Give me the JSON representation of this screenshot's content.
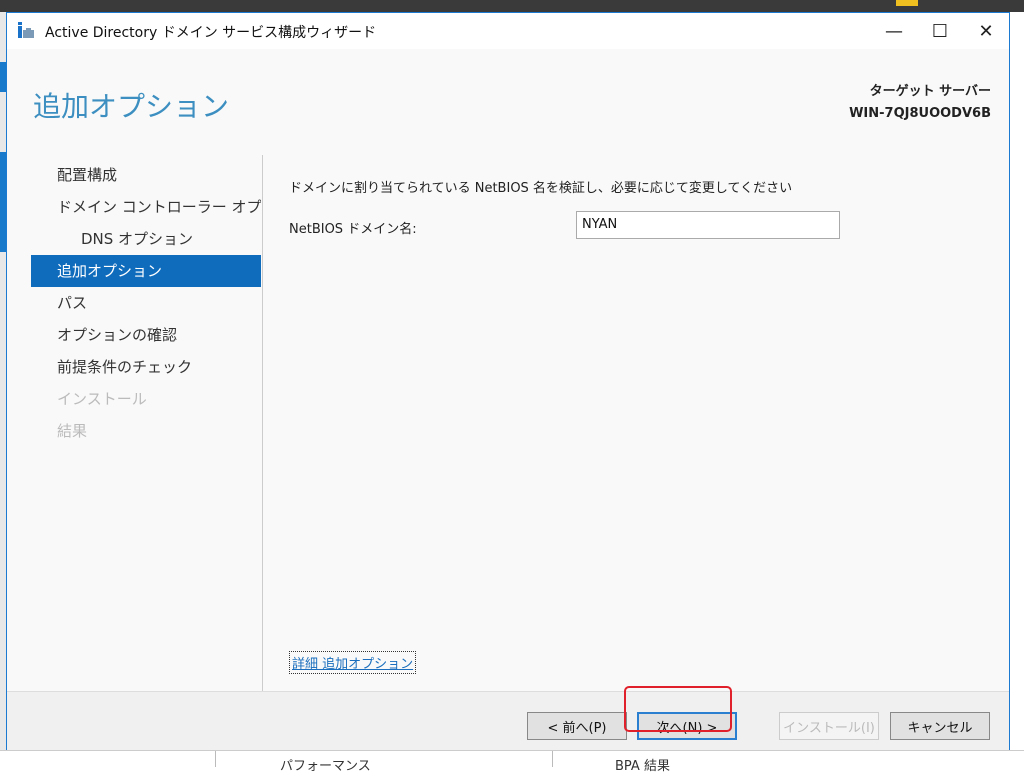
{
  "window": {
    "title": "Active Directory ドメイン サービス構成ウィザード",
    "minimize": "—",
    "maximize": "☐",
    "close": "✕"
  },
  "page_title": "追加オプション",
  "target": {
    "label": "ターゲット サーバー",
    "server": "WIN-7QJ8UOODV6B"
  },
  "nav": [
    {
      "label": "配置構成",
      "state": "normal"
    },
    {
      "label": "ドメイン コントローラー オプション",
      "state": "normal"
    },
    {
      "label": "DNS オプション",
      "state": "sub"
    },
    {
      "label": "追加オプション",
      "state": "active"
    },
    {
      "label": "パス",
      "state": "normal"
    },
    {
      "label": "オプションの確認",
      "state": "normal"
    },
    {
      "label": "前提条件のチェック",
      "state": "normal"
    },
    {
      "label": "インストール",
      "state": "disabled"
    },
    {
      "label": "結果",
      "state": "disabled"
    }
  ],
  "main": {
    "description": "ドメインに割り当てられている NetBIOS 名を検証し、必要に応じて変更してください",
    "netbios_label": "NetBIOS ドメイン名:",
    "netbios_value": "NYAN",
    "more_link": "詳細 追加オプション"
  },
  "buttons": {
    "back": "< 前へ(P)",
    "next": "次へ(N) >",
    "install": "インストール(I)",
    "cancel": "キャンセル"
  },
  "background": {
    "left_text": "パフォーマンス",
    "right_text": "BPA 結果"
  }
}
